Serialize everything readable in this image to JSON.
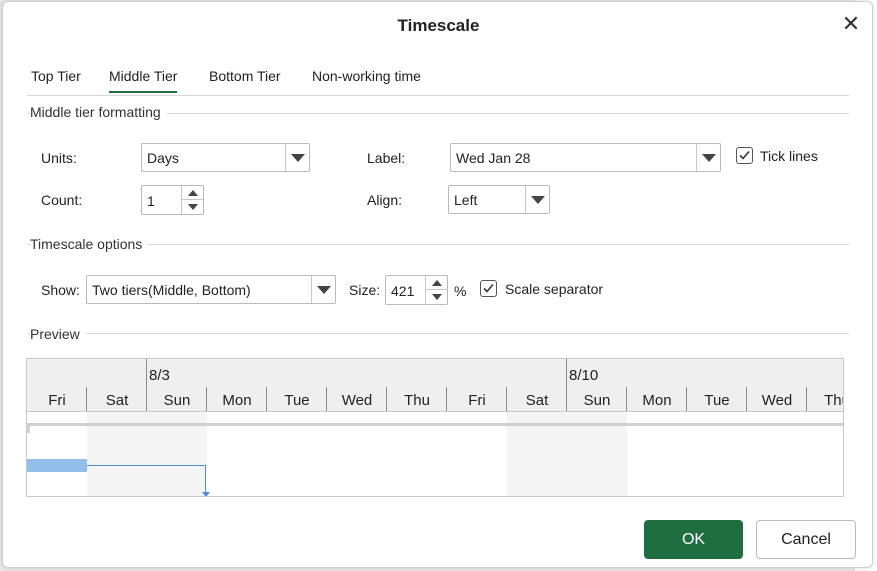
{
  "dialog": {
    "title": "Timescale"
  },
  "tabs": [
    {
      "label": "Top Tier",
      "active": false
    },
    {
      "label": "Middle Tier",
      "active": true
    },
    {
      "label": "Bottom Tier",
      "active": false
    },
    {
      "label": "Non-working time",
      "active": false
    }
  ],
  "middle_tier": {
    "section_title": "Middle tier formatting",
    "units_label": "Units:",
    "units_value": "Days",
    "label_label": "Label:",
    "label_value": "Wed Jan 28",
    "tick_lines_label": "Tick lines",
    "tick_lines_checked": true,
    "count_label": "Count:",
    "count_value": "1",
    "align_label": "Align:",
    "align_value": "Left"
  },
  "timescale_options": {
    "section_title": "Timescale options",
    "show_label": "Show:",
    "show_value": "Two tiers(Middle, Bottom)",
    "size_label": "Size:",
    "size_value": "421",
    "size_unit": "%",
    "scale_separator_label": "Scale separator",
    "scale_separator_checked": true
  },
  "preview": {
    "section_title": "Preview",
    "top_tier_labels": [
      "8/3",
      "8/10"
    ],
    "days": [
      "Fri",
      "Sat",
      "Sun",
      "Mon",
      "Tue",
      "Wed",
      "Thu",
      "Fri",
      "Sat",
      "Sun",
      "Mon",
      "Tue",
      "Wed",
      "Thu"
    ]
  },
  "buttons": {
    "ok": "OK",
    "cancel": "Cancel"
  },
  "colors": {
    "accent": "#1e6e3f",
    "task_bar": "#92bfea",
    "link_line": "#4a8fd8"
  }
}
